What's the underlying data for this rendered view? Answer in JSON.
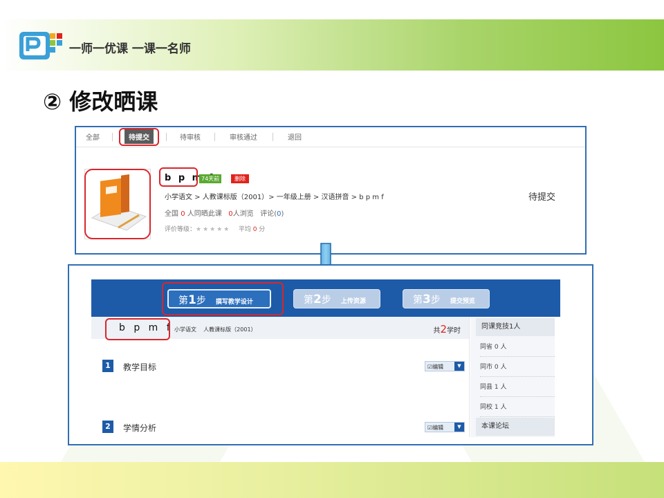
{
  "header": {
    "slogan": "一师一优课 一课一名师",
    "slide_title": "② 修改晒课"
  },
  "panel1": {
    "tabs": [
      "全部",
      "待提交",
      "待审核",
      "审核通过",
      "退回"
    ],
    "active_tab": "待提交",
    "lesson_title": "b p m f",
    "age_badge": "74天前",
    "delete_badge": "删除",
    "breadcrumb": "小学语文 > 人教课标版（2001）> 一年级上册 > 汉语拼音   > b p m f",
    "stats": {
      "prefix": "全国 ",
      "count": "0",
      "same_text": " 人同晒此课",
      "views_count": "0",
      "views_text": "人浏览",
      "comments_label": "评论(",
      "comments_count": "0",
      "comments_close": ")"
    },
    "rating": {
      "label": "评价等级：",
      "stars": "★★★★★",
      "avg_label": "平均 ",
      "avg_value": "0",
      "avg_unit": " 分"
    },
    "status": "待提交"
  },
  "panel2": {
    "steps": [
      {
        "prefix": "第",
        "num": "1",
        "suffix": "步",
        "label": "撰写教学设计"
      },
      {
        "prefix": "第",
        "num": "2",
        "suffix": "步",
        "label": "上传资源"
      },
      {
        "prefix": "第",
        "num": "3",
        "suffix": "步",
        "label": "提交预览"
      }
    ],
    "lesson_title": "b p m f",
    "subject": "小学语文",
    "edition": "人教课标版（2001）",
    "periods": {
      "prefix": "共",
      "value": "2",
      "suffix": "学时"
    },
    "sections": [
      {
        "num": "1",
        "title": "教学目标",
        "edit": "编辑"
      },
      {
        "num": "2",
        "title": "学情分析",
        "edit": "编辑"
      }
    ],
    "sidebar": {
      "head": "同课竞技1人",
      "items": [
        "同省 0 人",
        "同市 0 人",
        "同县 1 人",
        "同校 1 人"
      ],
      "forum": "本课论坛"
    }
  }
}
